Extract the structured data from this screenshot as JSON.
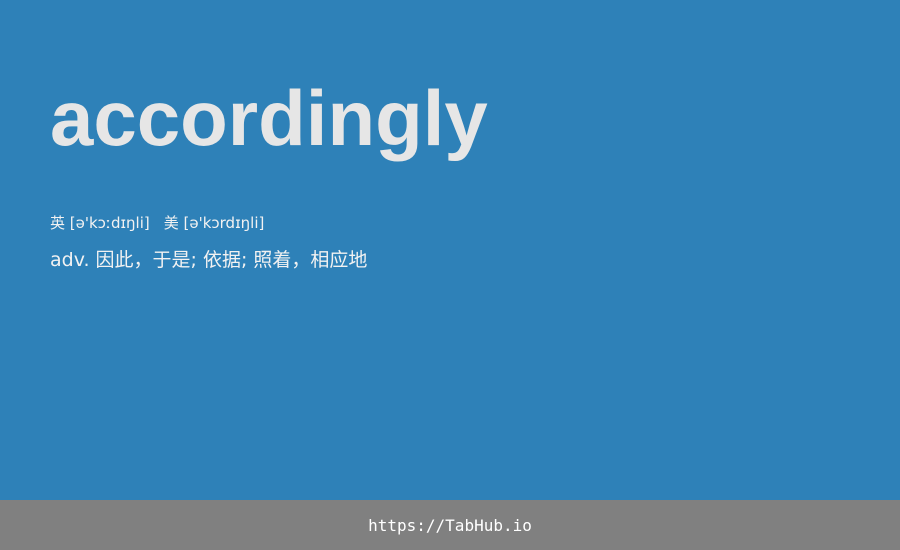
{
  "word": "accordingly",
  "pronunciation": {
    "uk": "英 [ə'kɔːdɪŋli]",
    "us": "美 [ə'kɔrdɪŋli]"
  },
  "definition": "adv. 因此，于是; 依据; 照着，相应地",
  "footer": {
    "link_text": "https://TabHub.io"
  },
  "colors": {
    "background": "#2e81b8",
    "footer": "#808080",
    "word_text": "#e6e6e6"
  }
}
